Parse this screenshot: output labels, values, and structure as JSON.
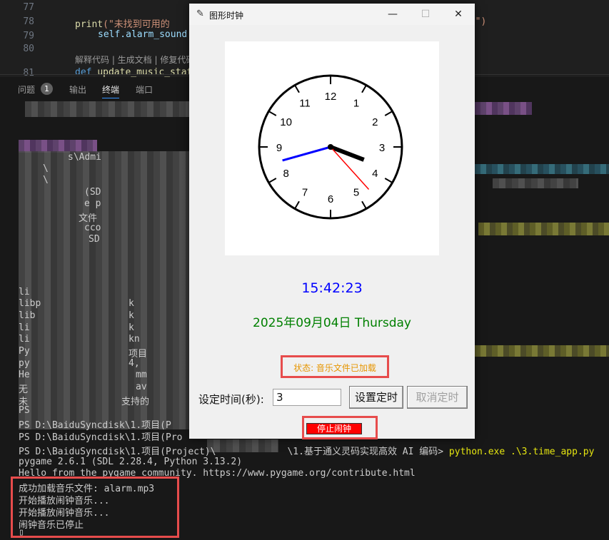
{
  "editor": {
    "line_numbers": [
      "77",
      "78",
      "79",
      "80",
      "81"
    ],
    "line78_call": "print",
    "line78_string_start": "(\"未找到可用的",
    "line78_string_end": "gg\")",
    "line79_code": "self.alarm_sound",
    "codelens": "解释代码 | 生成文档 | 修复代码",
    "line81_kw": "def",
    "line81_fn": "update_music_stat"
  },
  "panel": {
    "tabs": [
      "问题",
      "输出",
      "终端",
      "端口"
    ],
    "problems_count": "1",
    "active_tab": "终端"
  },
  "terminal": {
    "partial_lines": [
      "s\\Admi",
      "\\",
      "\\",
      "(SD",
      "e p",
      "文件",
      "cco",
      "SD",
      "li",
      "libp",
      "lib",
      "li",
      "li",
      "Py",
      "py",
      "He",
      "无",
      "未",
      "PS",
      "PS D:\\BaiduSyncdisk\\1.项目(P",
      "PS D:\\BaiduSyncdisk\\1.项目(Pro"
    ],
    "partial_right": [
      "项目",
      "4,",
      "mm",
      "av",
      "支持的",
      "k",
      "k",
      "k",
      "kn"
    ],
    "prompt_prefix": "PS D:\\BaiduSyncdisk\\1.项目(Project)\\",
    "prompt_suffix": "\\1.基于通义灵码实现高效 AI 编码>",
    "command": "python.exe .\\3.time_app.py",
    "pygame_version": "pygame 2.6.1 (SDL 2.28.4, Python 3.13.2)",
    "hello_line": "Hello from the pygame community. https://www.pygame.org/contribute.html",
    "output_lines": [
      "成功加载音乐文件: alarm.mp3",
      "开始播放闹钟音乐...",
      "开始播放闹钟音乐...",
      "闹钟音乐已停止"
    ],
    "cursor": "▯"
  },
  "app": {
    "title": "图形时钟",
    "minimize": "—",
    "maximize": "☐",
    "close": "✕",
    "clock": {
      "numbers": [
        "12",
        "1",
        "2",
        "3",
        "4",
        "5",
        "6",
        "7",
        "8",
        "9",
        "10",
        "11"
      ],
      "hour": 15,
      "minute": 42,
      "second": 23
    },
    "time": "15:42:23",
    "date": "2025年09月04日 Thursday",
    "status": "状态: 音乐文件已加载",
    "set_time_label": "设定时间(秒):",
    "seconds_value": "3",
    "set_timer_button": "设置定时",
    "cancel_timer_button": "取消定时",
    "stop_alarm_button": "停止闹钟",
    "colors": {
      "time": "#0000ff",
      "date": "#008000",
      "status": "#e69500",
      "stop_button": "#ff0000",
      "highlight_box": "#e74c4c",
      "minute_hand": "#0000ff",
      "second_hand": "#ff0000",
      "hour_hand": "#000000"
    }
  }
}
